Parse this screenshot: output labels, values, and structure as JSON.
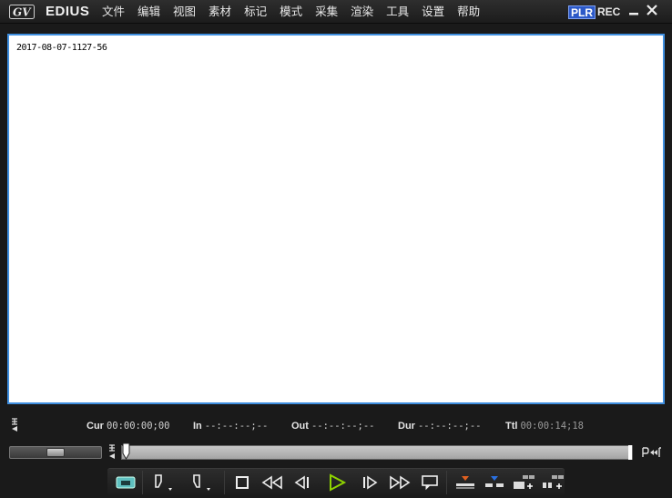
{
  "app": {
    "name": "EDIUS"
  },
  "menu": [
    "文件",
    "编辑",
    "视图",
    "素材",
    "标记",
    "模式",
    "采集",
    "渲染",
    "工具",
    "设置",
    "帮助"
  ],
  "mode": {
    "plr": "PLR",
    "rec": "REC"
  },
  "viewer": {
    "clip_name": "2017-08-07-1127-56"
  },
  "timecodes": {
    "cur_label": "Cur",
    "cur_value": "00:00:00;00",
    "in_label": "In",
    "in_value": "--:--:--;--",
    "out_label": "Out",
    "out_value": "--:--:--;--",
    "dur_label": "Dur",
    "dur_value": "--:--:--;--",
    "ttl_label": "Ttl",
    "ttl_value": "00:00:14;18"
  },
  "colors": {
    "viewer_border": "#3f8fe0",
    "plr_bg": "#2c59c8",
    "play": "#8fd400"
  },
  "icons": {
    "title": [
      "edius-logo-icon",
      "minimize-icon",
      "close-icon"
    ],
    "transport": [
      "overwrite-icon",
      "set-in-icon",
      "set-out-icon",
      "stop-icon",
      "rewind-icon",
      "step-back-icon",
      "play-icon",
      "step-forward-icon",
      "fast-forward-icon",
      "loop-icon",
      "insert-to-timeline-icon",
      "overwrite-to-timeline-icon",
      "add-to-bin-icon",
      "add-marker-icon"
    ]
  }
}
